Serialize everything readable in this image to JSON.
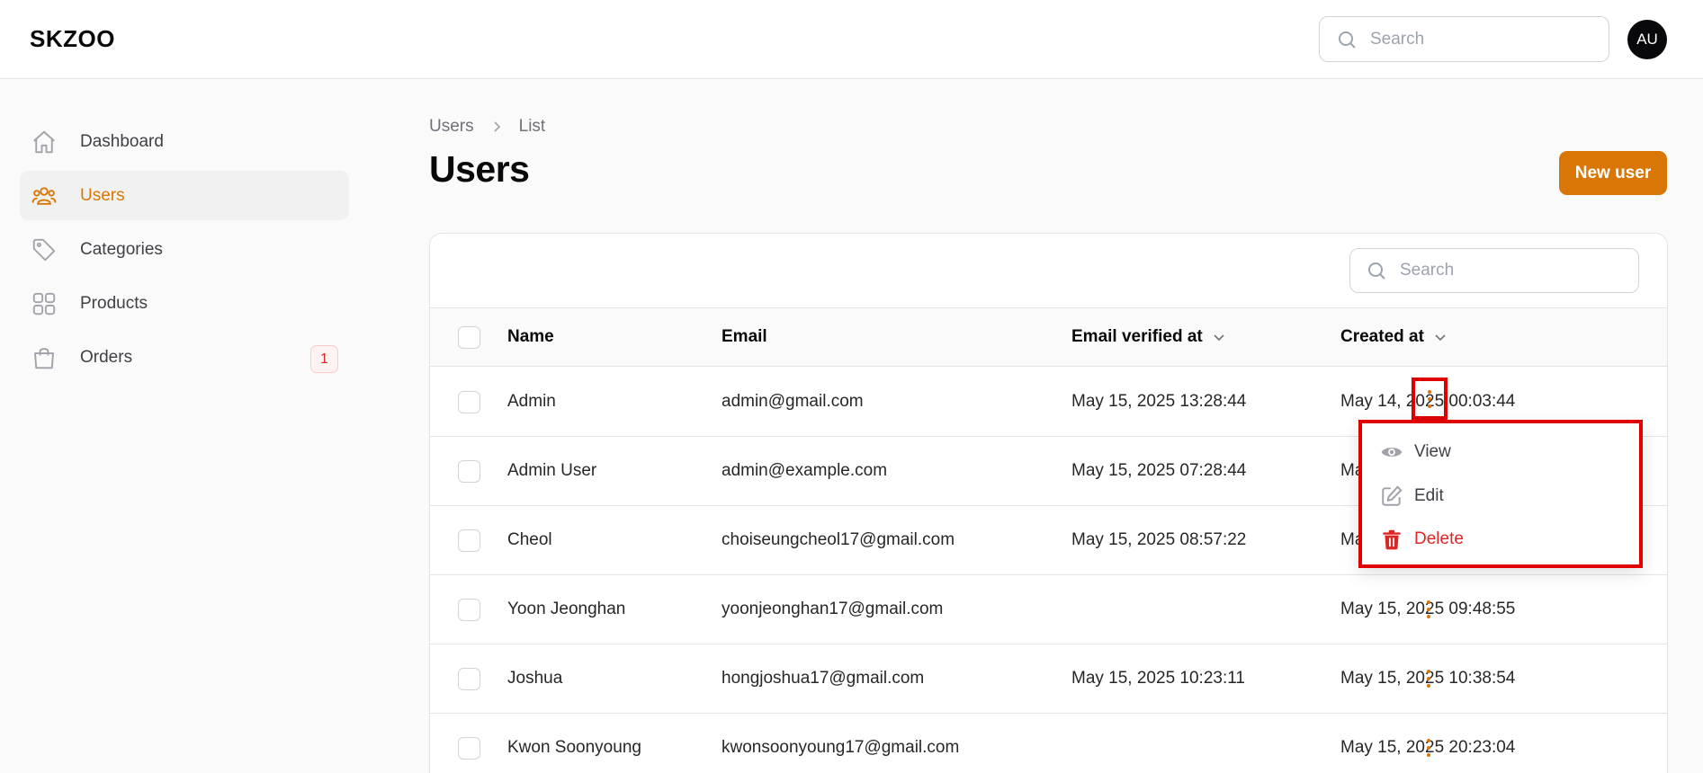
{
  "app": {
    "brand": "SKZOO"
  },
  "header": {
    "search_placeholder": "Search",
    "avatar_initials": "AU"
  },
  "sidebar": {
    "items": [
      {
        "label": "Dashboard",
        "icon": "home-icon",
        "active": false
      },
      {
        "label": "Users",
        "icon": "users-icon",
        "active": true
      },
      {
        "label": "Categories",
        "icon": "tag-icon",
        "active": false
      },
      {
        "label": "Products",
        "icon": "grid-icon",
        "active": false
      },
      {
        "label": "Orders",
        "icon": "shopping-bag-icon",
        "active": false,
        "badge": "1"
      }
    ]
  },
  "breadcrumb": {
    "items": [
      "Users",
      "List"
    ]
  },
  "page": {
    "title": "Users",
    "new_button": "New user"
  },
  "table": {
    "search_placeholder": "Search",
    "columns": {
      "name": "Name",
      "email": "Email",
      "verified": "Email verified at",
      "created": "Created at"
    },
    "rows": [
      {
        "name": "Admin",
        "email": "admin@gmail.com",
        "verified": "May 15, 2025 13:28:44",
        "created": "May 14, 2025 00:03:44"
      },
      {
        "name": "Admin User",
        "email": "admin@example.com",
        "verified": "May 15, 2025 07:28:44",
        "created": "Ma"
      },
      {
        "name": "Cheol",
        "email": "choiseungcheol17@gmail.com",
        "verified": "May 15, 2025 08:57:22",
        "created": "Ma"
      },
      {
        "name": "Yoon Jeonghan",
        "email": "yoonjeonghan17@gmail.com",
        "verified": "",
        "created": "May 15, 2025 09:48:55"
      },
      {
        "name": "Joshua",
        "email": "hongjoshua17@gmail.com",
        "verified": "May 15, 2025 10:23:11",
        "created": "May 15, 2025 10:38:54"
      },
      {
        "name": "Kwon Soonyoung",
        "email": "kwonsoonyoung17@gmail.com",
        "verified": "",
        "created": "May 15, 2025 20:23:04"
      }
    ]
  },
  "row_menu": {
    "view": "View",
    "edit": "Edit",
    "delete": "Delete"
  },
  "colors": {
    "accent": "#d97706",
    "danger": "#dc2626",
    "highlight": "#e00000"
  }
}
